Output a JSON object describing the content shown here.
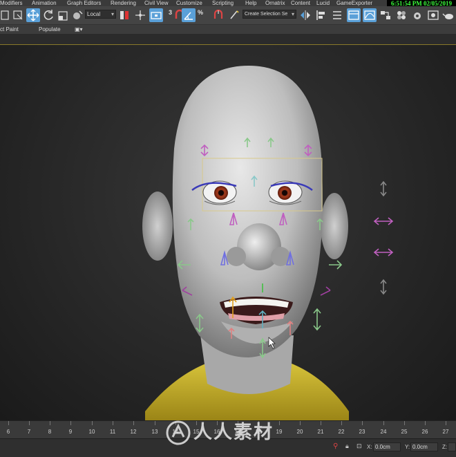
{
  "menubar": {
    "items": [
      "Modifiers",
      "Animation",
      "Graph Editors",
      "Rendering",
      "Civil View",
      "Customize",
      "Scripting",
      "Help",
      "Ornatrix",
      "Content",
      "Lucid",
      "GameExporter"
    ],
    "clock": "6:51:54 PM 02/05/2019"
  },
  "toolbar": {
    "ref_coord_system": "Local",
    "selection_set_placeholder": "Create Selection Se",
    "snap_label": "3",
    "percent_label": "%"
  },
  "ribbon": {
    "items": [
      "ct Paint",
      "Populate"
    ]
  },
  "timeline": {
    "frames": [
      "6",
      "7",
      "8",
      "9",
      "10",
      "11",
      "12",
      "13",
      "14",
      "15",
      "16",
      "17",
      "18",
      "19",
      "20",
      "21",
      "22",
      "23",
      "24",
      "25",
      "26",
      "27"
    ]
  },
  "statusbar": {
    "x_label": "X:",
    "x_value": "0.0cm",
    "y_label": "Y:",
    "y_value": "0.0cm",
    "z_label": "Z:"
  },
  "watermark": "人人素材",
  "colors": {
    "selection_accent": "#5aa0d8",
    "clock_text": "#3cff3c",
    "shirt": "#c9b22c",
    "viewport_border": "#8a7a2a"
  }
}
